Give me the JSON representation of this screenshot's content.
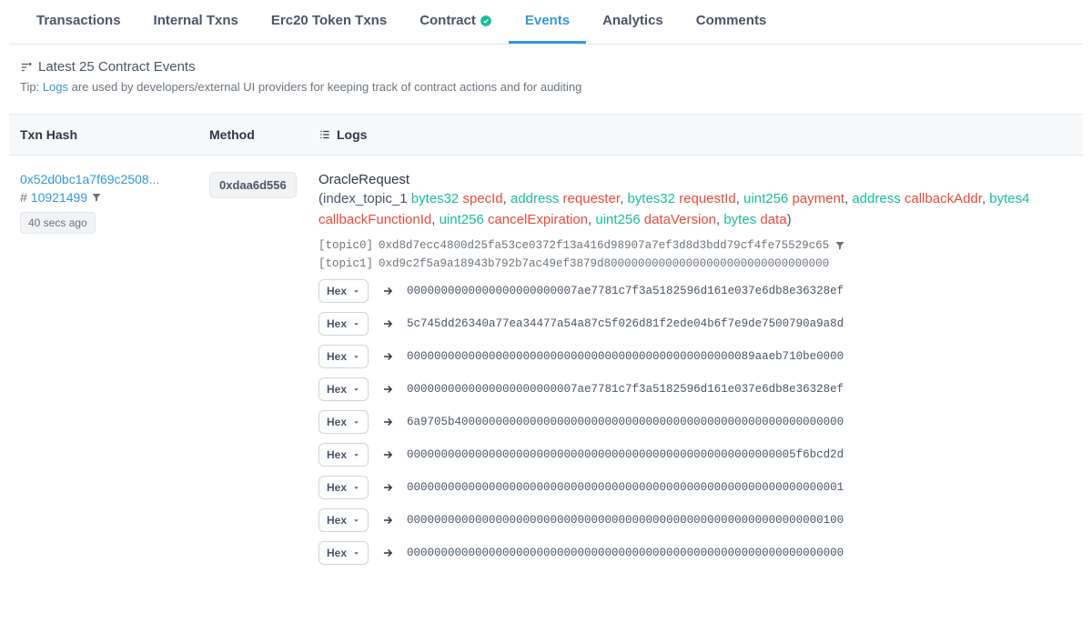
{
  "tabs": [
    {
      "label": "Transactions",
      "active": false,
      "verified": false
    },
    {
      "label": "Internal Txns",
      "active": false,
      "verified": false
    },
    {
      "label": "Erc20 Token Txns",
      "active": false,
      "verified": false
    },
    {
      "label": "Contract",
      "active": false,
      "verified": true
    },
    {
      "label": "Events",
      "active": true,
      "verified": false
    },
    {
      "label": "Analytics",
      "active": false,
      "verified": false
    },
    {
      "label": "Comments",
      "active": false,
      "verified": false
    }
  ],
  "section": {
    "title": "Latest 25 Contract Events",
    "tip_prefix": "Tip: ",
    "tip_link": "Logs",
    "tip_suffix": " are used by developers/external UI providers for keeping track of contract actions and for auditing"
  },
  "headers": {
    "hash": "Txn Hash",
    "method": "Method",
    "logs": "Logs"
  },
  "event": {
    "hash": "0x52d0bc1a7f69c2508...",
    "block_prefix": "# ",
    "block": "10921499",
    "time": "40 secs ago",
    "method": "0xdaa6d556",
    "name": "OracleRequest",
    "sig_prefix": "(index_topic_1 ",
    "params": [
      {
        "type": "bytes32",
        "name": "specId"
      },
      {
        "type": "address",
        "name": "requester"
      },
      {
        "type": "bytes32",
        "name": "requestId"
      },
      {
        "type": "uint256",
        "name": "payment"
      },
      {
        "type": "address",
        "name": "callbackAddr"
      },
      {
        "type": "bytes4",
        "name": "callbackFunctionId"
      },
      {
        "type": "uint256",
        "name": "cancelExpiration"
      },
      {
        "type": "uint256",
        "name": "dataVersion"
      },
      {
        "type": "bytes",
        "name": "data"
      }
    ],
    "sig_suffix": ")",
    "topics": [
      {
        "label": "[topic0]",
        "value": "0xd8d7ecc4800d25fa53ce0372f13a416d98907a7ef3d8d3bdd79cf4fe75529c65",
        "filter": true
      },
      {
        "label": "[topic1]",
        "value": "0xd9c2f5a9a18943b792b7ac49ef3879d800000000000000000000000000000000",
        "filter": false
      }
    ],
    "hex_label": "Hex",
    "data": [
      "0000000000000000000000007ae7781c7f3a5182596d161e037e6db8e36328ef",
      "5c745dd26340a77ea34477a54a87c5f026d81f2ede04b6f7e9de7500790a9a8d",
      "000000000000000000000000000000000000000000000000089aaeb710be0000",
      "0000000000000000000000007ae7781c7f3a5182596d161e037e6db8e36328ef",
      "6a9705b400000000000000000000000000000000000000000000000000000000",
      "000000000000000000000000000000000000000000000000000000005f6bcd2d",
      "0000000000000000000000000000000000000000000000000000000000000001",
      "0000000000000000000000000000000000000000000000000000000000000100",
      "0000000000000000000000000000000000000000000000000000000000000000"
    ]
  }
}
